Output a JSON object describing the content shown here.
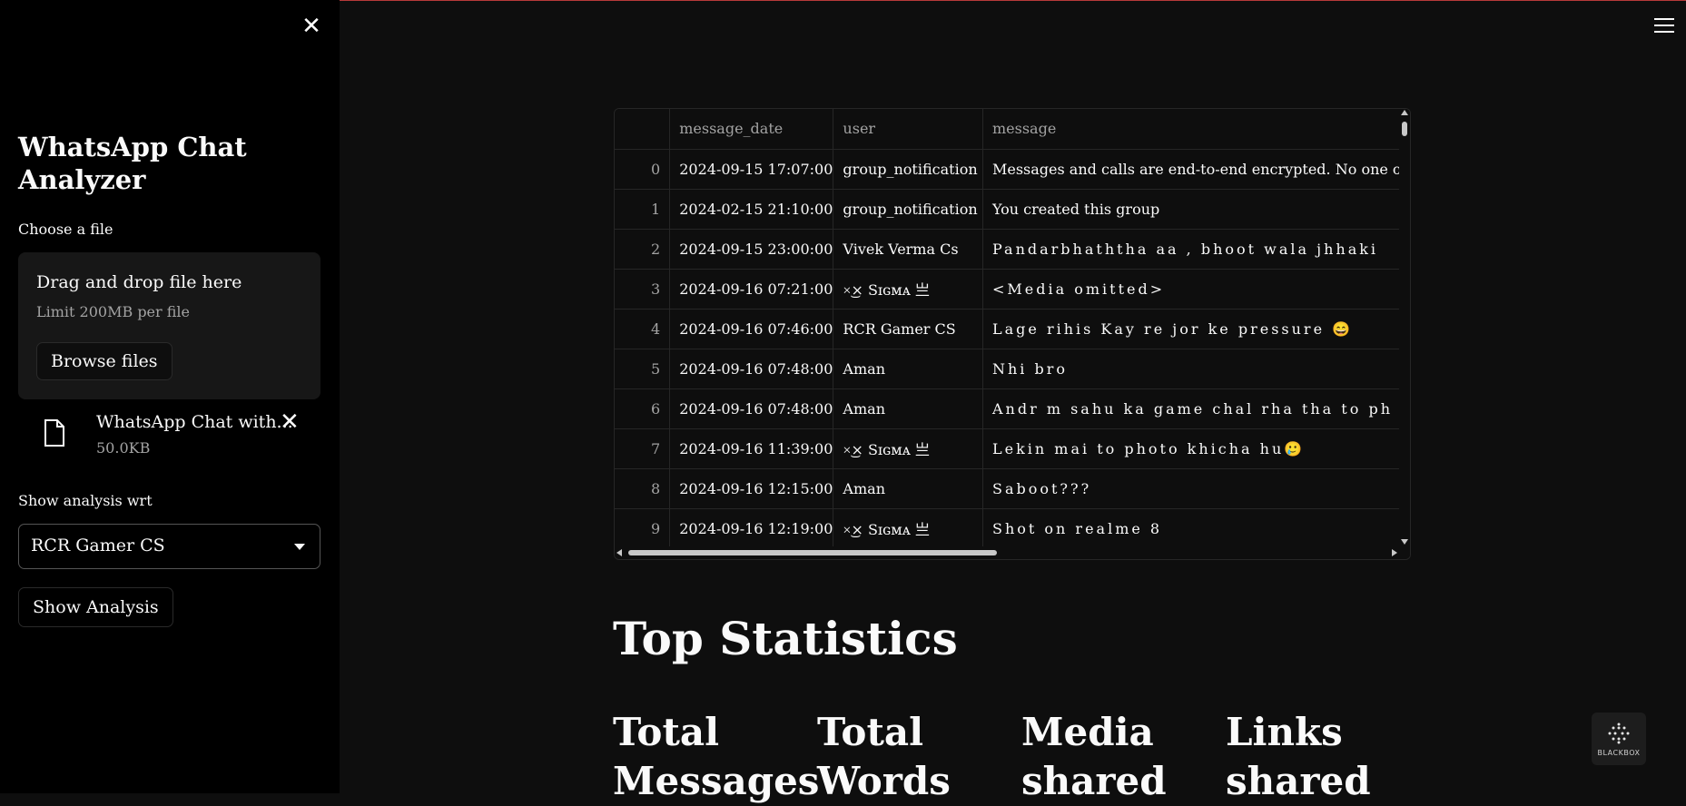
{
  "sidebar": {
    "app_title": "WhatsApp Chat Analyzer",
    "choose_file_label": "Choose a file",
    "dropzone": {
      "title": "Drag and drop file here",
      "subtitle": "Limit 200MB per file",
      "browse_label": "Browse files"
    },
    "uploaded_file": {
      "name": "WhatsApp Chat with...",
      "size": "50.0KB"
    },
    "analysis_label": "Show analysis wrt",
    "selected_user": "RCR Gamer CS",
    "show_button_label": "Show Analysis"
  },
  "dataframe": {
    "columns": [
      "",
      "message_date",
      "user",
      "message"
    ],
    "rows": [
      {
        "idx": "0",
        "date": "2024-09-15 17:07:00",
        "user": "group_notification",
        "message": "Messages and calls are end-to-end encrypted. No one outside"
      },
      {
        "idx": "1",
        "date": "2024-02-15 21:10:00",
        "user": "group_notification",
        "message": "You created this group"
      },
      {
        "idx": "2",
        "date": "2024-09-15 23:00:00",
        "user": "Vivek Verma Cs",
        "message": "Pandarbhaththa aa , bhoot wala jhhaki"
      },
      {
        "idx": "3",
        "date": "2024-09-16 07:21:00",
        "user": "×͜× Sɪɢᴍᴀ 亗",
        "message": "<Media omitted>"
      },
      {
        "idx": "4",
        "date": "2024-09-16 07:46:00",
        "user": "RCR Gamer CS",
        "message": "Lage rihis Kay re jor ke pressure 😄"
      },
      {
        "idx": "5",
        "date": "2024-09-16 07:48:00",
        "user": "Aman",
        "message": "Nhi bro"
      },
      {
        "idx": "6",
        "date": "2024-09-16 07:48:00",
        "user": "Aman",
        "message": "Andr m sahu ka game chal rha tha to ph"
      },
      {
        "idx": "7",
        "date": "2024-09-16 11:39:00",
        "user": "×͜× Sɪɢᴍᴀ 亗",
        "message": "Lekin mai to photo khicha hu🥲"
      },
      {
        "idx": "8",
        "date": "2024-09-16 12:15:00",
        "user": "Aman",
        "message": "Saboot???"
      },
      {
        "idx": "9",
        "date": "2024-09-16 12:19:00",
        "user": "×͜× Sɪɢᴍᴀ 亗",
        "message": "Shot on realme 8"
      }
    ]
  },
  "main": {
    "section_title": "Top Statistics",
    "stats": [
      "Total Messages",
      "Total Words",
      "Media shared",
      "Links shared"
    ]
  },
  "badge": {
    "text": "BLACKBOX"
  },
  "colors": {
    "accent": "#ff4b4b",
    "sidebar_bg": "#000000",
    "main_bg": "#0e0e0e"
  }
}
